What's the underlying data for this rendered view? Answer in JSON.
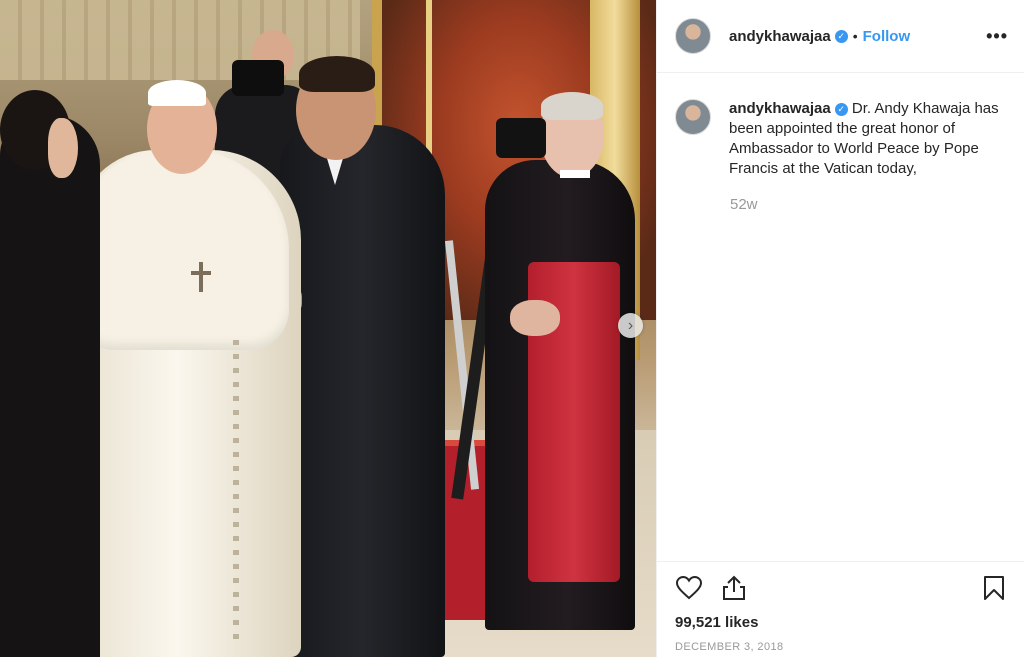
{
  "post": {
    "username": "andykhawajaa",
    "verified_badge": "✓",
    "separator": "•",
    "follow_label": "Follow",
    "more_label": "•••",
    "caption": "Dr. Andy Khawaja has been appointed the great honor of Ambassador to World Peace by Pope Francis at the Vatican today,",
    "time_ago": "52w",
    "likes": "99,521 likes",
    "date": "DECEMBER 3, 2018",
    "next_arrow": "›"
  },
  "icons": {
    "like": "heart-icon",
    "share": "share-icon",
    "save": "bookmark-icon",
    "next": "chevron-right-icon"
  },
  "colors": {
    "link_blue": "#3897f0",
    "text": "#262626",
    "muted": "#999999",
    "border": "#efefef"
  }
}
